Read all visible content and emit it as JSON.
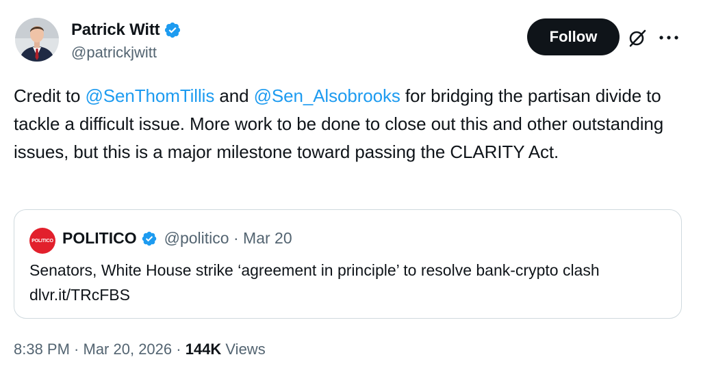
{
  "author": {
    "name": "Patrick Witt",
    "handle": "@patrickjwitt"
  },
  "actions": {
    "follow_label": "Follow"
  },
  "tweet": {
    "part1": "Credit to ",
    "mention1": "@SenThomTillis",
    "part2": " and ",
    "mention2": "@Sen_Alsobrooks",
    "part3": " for bridging the partisan divide to tackle a difficult issue. More work to be done to close out this and other outstanding issues, but this is a major milestone toward passing the CLARITY Act."
  },
  "quote": {
    "avatar_text": "POLITICO",
    "name": "POLITICO",
    "handle": "@politico",
    "separator": " · ",
    "date": "Mar 20",
    "text": "Senators, White House strike ‘agreement in principle’ to resolve bank-crypto clash dlvr.it/TRcFBS"
  },
  "footer": {
    "time": "8:38 PM",
    "separator": " · ",
    "date": "Mar 20, 2026",
    "separator2": " · ",
    "views_count": "144K",
    "views_label": " Views"
  },
  "colors": {
    "link": "#1d9bf0",
    "text": "#0f1419",
    "muted": "#536471",
    "verified": "#1d9bf0",
    "politico_red": "#e2202c"
  },
  "icons": {
    "verified": "verified-badge-icon",
    "grok": "grok-icon",
    "more": "more-horizontal-icon"
  }
}
